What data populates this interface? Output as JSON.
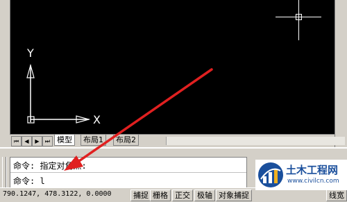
{
  "canvas": {
    "ucs_y_label": "Y",
    "ucs_x_label": "X"
  },
  "layout_tabs": {
    "nav": [
      "⏮",
      "◀",
      "▶",
      "⏭"
    ],
    "tabs": [
      "模型",
      "布局1",
      "布局2"
    ],
    "active": "模型"
  },
  "command": {
    "line1": "命令: 指定对角点:",
    "line2": "命令: l"
  },
  "status_bar": {
    "coordinates": "790.1247,  478.3122, 0.0000",
    "buttons": [
      "捕捉",
      "栅格",
      "正交",
      "极轴",
      "对象捕捉",
      "线宽"
    ]
  },
  "watermark": {
    "name": "土木工程网",
    "url": "www.civilcn.com"
  },
  "colors": {
    "canvas_bg": "#000000",
    "arrow": "#e02020",
    "watermark_blue": "#1a4f9c"
  }
}
